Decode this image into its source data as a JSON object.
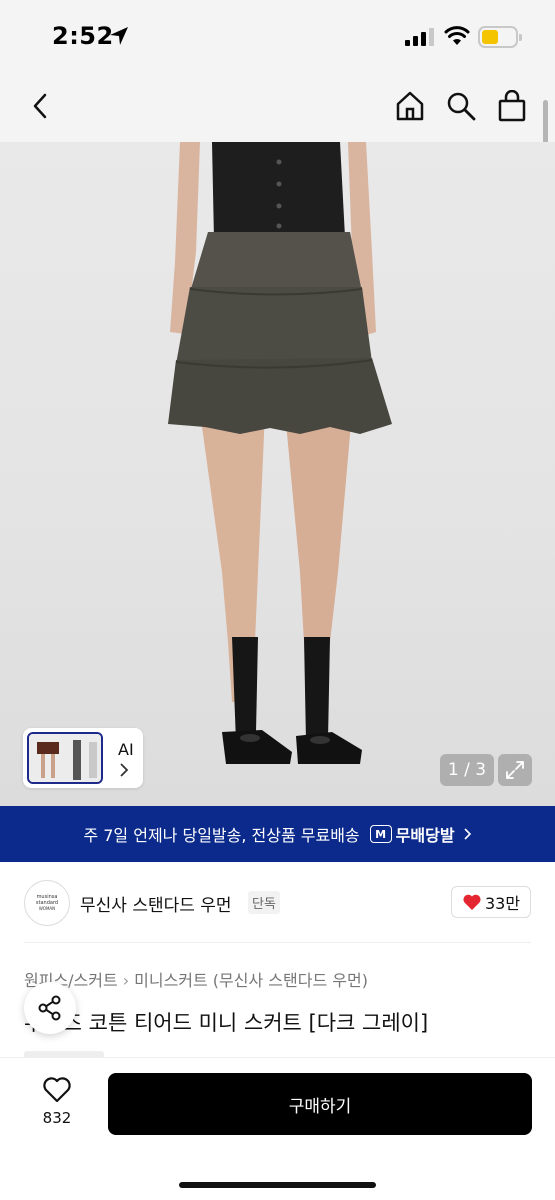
{
  "status_bar": {
    "time": "2:52"
  },
  "nav": {
    "icons": [
      "back-icon",
      "home-icon",
      "search-icon",
      "shopping-bag-icon"
    ]
  },
  "gallery": {
    "thumb_label": "AI",
    "page_indicator": "1 / 3"
  },
  "shipping_banner": {
    "text": "주 7일 언제나 당일발송, 전상품 무료배송",
    "badge_label": "무배당발",
    "badge_mark": "M"
  },
  "brand": {
    "logo_line1": "musinsa",
    "logo_line2": "standard",
    "logo_line3": "WOMAN",
    "name": "무신사 스탠다드 우먼",
    "tag": "단독",
    "likes": "33만"
  },
  "breadcrumb": {
    "category": "원피스/스커트",
    "subcategory": "미니스커트 (무신사 스탠다드 우먼)"
  },
  "product": {
    "title": "우먼즈 코튼 티어드 미니 스커트 [다크 그레이]"
  },
  "bottom_bar": {
    "wish_count": "832",
    "buy_label": "구매하기"
  },
  "colors": {
    "banner": "#0b2a8c",
    "heart": "#e3262f",
    "buy_button": "#000000"
  }
}
